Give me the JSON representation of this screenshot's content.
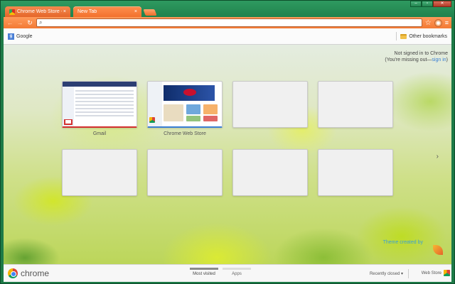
{
  "window": {
    "controls": [
      "–",
      "▫",
      "✕"
    ]
  },
  "tabs": [
    {
      "title": "Chrome Web Store - Home",
      "close": "×"
    },
    {
      "title": "New Tab",
      "close": "×"
    }
  ],
  "toolbar": {
    "back_glyph": "←",
    "forward_glyph": "→",
    "reload_glyph": "↻",
    "search_glyph": "⌕",
    "omnibox_value": "",
    "star_glyph": "☆",
    "menu_glyph": "≡"
  },
  "bookmarks": {
    "items": [
      {
        "label": "Google",
        "icon": "google-icon",
        "glyph": "g"
      }
    ],
    "other": "Other bookmarks"
  },
  "signin": {
    "line1": "Not signed in to Chrome",
    "line2_prefix": "(You're missing out—",
    "line2_link": "sign in",
    "line2_suffix": ")"
  },
  "tiles": [
    {
      "label": "Gmail",
      "thumb": "gmail"
    },
    {
      "label": "Chrome Web Store",
      "thumb": "cws"
    },
    {
      "label": "",
      "thumb": "empty"
    },
    {
      "label": "",
      "thumb": "empty"
    },
    {
      "label": "",
      "thumb": "empty"
    },
    {
      "label": "",
      "thumb": "empty"
    },
    {
      "label": "",
      "thumb": "empty"
    },
    {
      "label": "",
      "thumb": "empty"
    }
  ],
  "page_arrow": "›",
  "theme_credit": "Theme created by",
  "footer": {
    "brand": "chrome",
    "tabs": [
      {
        "label": "Most visited",
        "active": true
      },
      {
        "label": "Apps",
        "active": false
      }
    ],
    "recently_closed": "Recently closed ▾",
    "web_store": "Web Store"
  }
}
